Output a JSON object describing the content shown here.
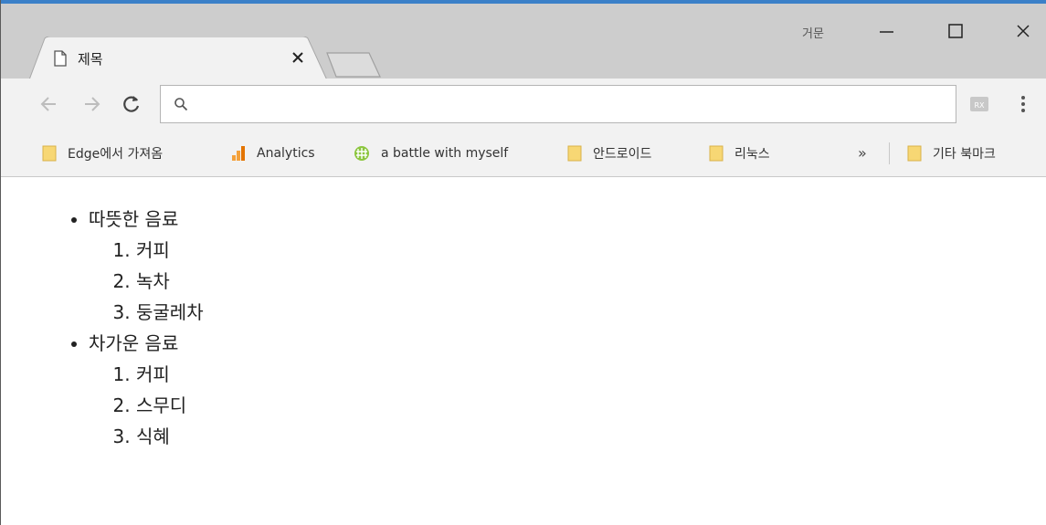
{
  "tab": {
    "title": "제목"
  },
  "titlebar": {
    "profile_name": "거문"
  },
  "omnibox": {
    "value": "",
    "placeholder": ""
  },
  "bookmarks": [
    {
      "label": "Edge에서 가져옴",
      "icon": "folder-icon"
    },
    {
      "label": "Analytics",
      "icon": "analytics-icon"
    },
    {
      "label": "a battle with myself",
      "icon": "globe-icon"
    },
    {
      "label": "안드로이드",
      "icon": "folder-icon"
    },
    {
      "label": "리눅스",
      "icon": "folder-icon"
    }
  ],
  "bookmarks_overflow": "»",
  "other_bookmarks": {
    "label": "기타 북마크",
    "icon": "folder-icon"
  },
  "content": {
    "groups": [
      {
        "title": "따뜻한 음료",
        "items": [
          "커피",
          "녹차",
          "둥굴레차"
        ]
      },
      {
        "title": "차가운 음료",
        "items": [
          "커피",
          "스무디",
          "식혜"
        ]
      }
    ]
  },
  "colors": {
    "accent": "#3b80c8",
    "folder": "#f7d774",
    "analytics_orange": "#f4a13b",
    "globe_green": "#8cc63f"
  }
}
